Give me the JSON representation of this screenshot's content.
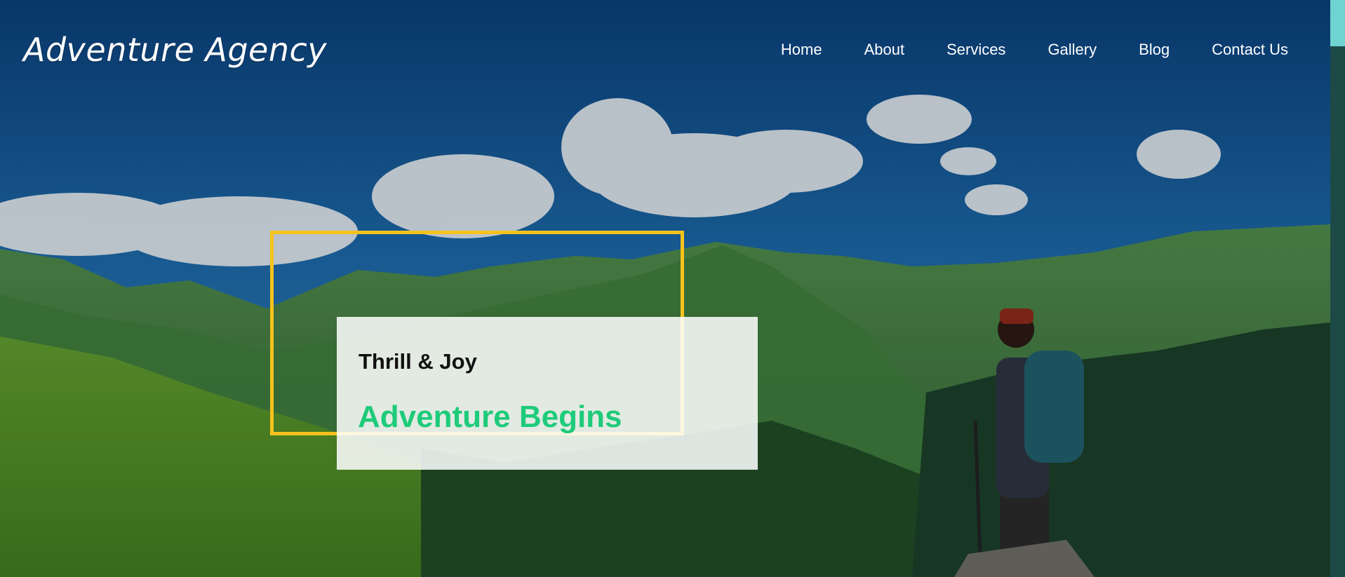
{
  "brand": {
    "name": "Adventure Agency"
  },
  "nav": {
    "items": [
      {
        "label": "Home"
      },
      {
        "label": "About"
      },
      {
        "label": "Services"
      },
      {
        "label": "Gallery"
      },
      {
        "label": "Blog"
      },
      {
        "label": "Contact Us"
      }
    ]
  },
  "hero": {
    "subtitle": "Thrill & Joy",
    "title": "Adventure Begins"
  },
  "colors": {
    "accent_frame": "#f6c21c",
    "title_green": "#1ecb7a",
    "scrollbar_track": "#1d4a47",
    "scrollbar_thumb": "#6fd3d0"
  }
}
